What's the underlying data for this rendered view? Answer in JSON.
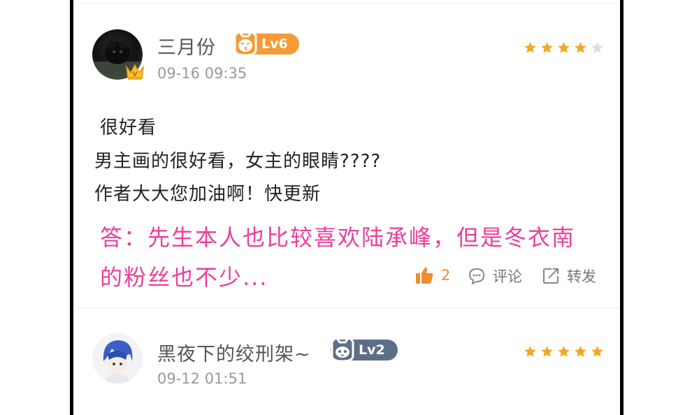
{
  "colors": {
    "star_filled": "#f5a623",
    "star_empty": "#dddddd",
    "reply_pink": "#ea3f9c",
    "badge_orange": "#f49a36",
    "badge_slate": "#5d6f86",
    "like_orange": "#f08c2f"
  },
  "comments": [
    {
      "username": "三月份",
      "level": "Lv6",
      "timestamp": "09-16 09:35",
      "rating": 4,
      "rating_max": 5,
      "vip_crown": true,
      "lines": [
        "很好看",
        "男主画的很好看，女主的眼睛????",
        "作者大大您加油啊！快更新"
      ],
      "reply_lines": [
        "答：先生本人也比较喜欢陆承峰，但是冬衣南",
        "的粉丝也不少..."
      ],
      "actions": {
        "like_icon": "thumbs-up-icon",
        "like_count": "2",
        "comment_icon": "comment-bubble-icon",
        "comment_label": "评论",
        "share_icon": "share-icon",
        "share_label": "转发"
      }
    },
    {
      "username": "黑夜下的绞刑架~",
      "level": "Lv2",
      "timestamp": "09-12 01:51",
      "rating": 5,
      "rating_max": 5
    }
  ]
}
